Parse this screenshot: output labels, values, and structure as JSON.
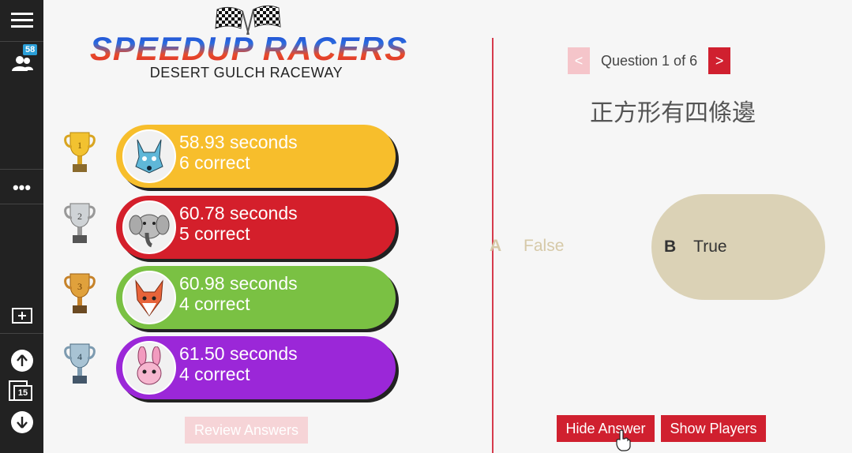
{
  "sidebar": {
    "participants_badge": "58",
    "slide_count": "15",
    "icons": [
      "menu-icon",
      "people-icon",
      "more-icon",
      "add-slide-icon",
      "arrow-up-icon",
      "slides-icon",
      "arrow-down-icon"
    ]
  },
  "logo": {
    "title": "SPEEDUP RACERS",
    "subtitle": "DESERT GULCH RACEWAY"
  },
  "leaderboard": [
    {
      "place": "1",
      "time": "58.93 seconds",
      "correct": "6 correct",
      "color": "#f7be2c",
      "avatar": "wolf-avatar"
    },
    {
      "place": "2",
      "time": "60.78 seconds",
      "correct": "5 correct",
      "color": "#d41f2b",
      "avatar": "elephant-avatar"
    },
    {
      "place": "3",
      "time": "60.98 seconds",
      "correct": "4 correct",
      "color": "#7ac143",
      "avatar": "fox-avatar"
    },
    {
      "place": "4",
      "time": "61.50 seconds",
      "correct": "4 correct",
      "color": "#9b27d8",
      "avatar": "rabbit-avatar"
    }
  ],
  "review_button": "Review Answers",
  "question": {
    "prev": "<",
    "next": ">",
    "counter": "Question 1 of 6",
    "text": "正方形有四條邊"
  },
  "answers": {
    "a": {
      "letter": "A",
      "text": "False"
    },
    "b": {
      "letter": "B",
      "text": "True"
    }
  },
  "buttons": {
    "hide_answer": "Hide Answer",
    "show_players": "Show Players"
  }
}
